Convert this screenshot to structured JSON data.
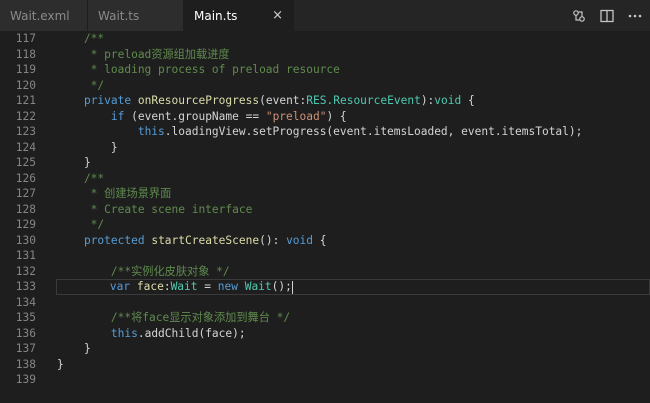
{
  "tabs": [
    {
      "label": "Wait.exml",
      "active": false
    },
    {
      "label": "Wait.ts",
      "active": false
    },
    {
      "label": "Main.ts",
      "active": true,
      "close": "×"
    }
  ],
  "tab_actions": [
    {
      "name": "open-changes-icon"
    },
    {
      "name": "split-editor-icon"
    },
    {
      "name": "more-actions-icon"
    }
  ],
  "colors": {
    "comment": "#608b4e",
    "keyword": "#569cd6",
    "function": "#dcdcaa",
    "type": "#4ec9b0",
    "string": "#ce9178",
    "text": "#d4d4d4",
    "line_number": "#858585",
    "background": "#1e1e1e"
  },
  "editor": {
    "current_line": 133,
    "lines": [
      {
        "num": "117",
        "tokens": [
          {
            "t": "    /**",
            "c": "cm"
          }
        ]
      },
      {
        "num": "118",
        "tokens": [
          {
            "t": "     * preload资源组加载进度",
            "c": "cm"
          }
        ]
      },
      {
        "num": "119",
        "tokens": [
          {
            "t": "     * loading process of preload resource",
            "c": "cm"
          }
        ]
      },
      {
        "num": "120",
        "tokens": [
          {
            "t": "     */",
            "c": "cm"
          }
        ]
      },
      {
        "num": "121",
        "tokens": [
          {
            "t": "    ",
            "c": "pl"
          },
          {
            "t": "private",
            "c": "kw"
          },
          {
            "t": " ",
            "c": "pl"
          },
          {
            "t": "onResourceProgress",
            "c": "fn"
          },
          {
            "t": "(",
            "c": "pl"
          },
          {
            "t": "event",
            "c": "pl"
          },
          {
            "t": ":",
            "c": "pl"
          },
          {
            "t": "RES.ResourceEvent",
            "c": "ty"
          },
          {
            "t": "):",
            "c": "pl"
          },
          {
            "t": "void",
            "c": "ty"
          },
          {
            "t": " {",
            "c": "pl"
          }
        ]
      },
      {
        "num": "122",
        "tokens": [
          {
            "t": "        ",
            "c": "pl"
          },
          {
            "t": "if",
            "c": "kw"
          },
          {
            "t": " (event.groupName == ",
            "c": "pl"
          },
          {
            "t": "\"preload\"",
            "c": "st"
          },
          {
            "t": ") {",
            "c": "pl"
          }
        ]
      },
      {
        "num": "123",
        "tokens": [
          {
            "t": "            ",
            "c": "pl"
          },
          {
            "t": "this",
            "c": "kw"
          },
          {
            "t": ".loadingView.setProgress(event.itemsLoaded, event.itemsTotal);",
            "c": "pl"
          }
        ]
      },
      {
        "num": "124",
        "tokens": [
          {
            "t": "        }",
            "c": "pl"
          }
        ]
      },
      {
        "num": "125",
        "tokens": [
          {
            "t": "    }",
            "c": "pl"
          }
        ]
      },
      {
        "num": "126",
        "tokens": [
          {
            "t": "    /**",
            "c": "cm"
          }
        ]
      },
      {
        "num": "127",
        "tokens": [
          {
            "t": "     * 创建场景界面",
            "c": "cm"
          }
        ]
      },
      {
        "num": "128",
        "tokens": [
          {
            "t": "     * Create scene interface",
            "c": "cm"
          }
        ]
      },
      {
        "num": "129",
        "tokens": [
          {
            "t": "     */",
            "c": "cm"
          }
        ]
      },
      {
        "num": "130",
        "tokens": [
          {
            "t": "    ",
            "c": "pl"
          },
          {
            "t": "protected",
            "c": "kw"
          },
          {
            "t": " ",
            "c": "pl"
          },
          {
            "t": "startCreateScene",
            "c": "fn"
          },
          {
            "t": "(): ",
            "c": "pl"
          },
          {
            "t": "void",
            "c": "kw"
          },
          {
            "t": " {",
            "c": "pl"
          }
        ]
      },
      {
        "num": "131",
        "tokens": []
      },
      {
        "num": "132",
        "tokens": [
          {
            "t": "        /**实例化皮肤对象 */",
            "c": "cm"
          }
        ]
      },
      {
        "num": "133",
        "tokens": [
          {
            "t": "        ",
            "c": "pl"
          },
          {
            "t": "var",
            "c": "kw"
          },
          {
            "t": " ",
            "c": "pl"
          },
          {
            "t": "face",
            "c": "fn"
          },
          {
            "t": ":",
            "c": "pl"
          },
          {
            "t": "Wait",
            "c": "ty"
          },
          {
            "t": " = ",
            "c": "pl"
          },
          {
            "t": "new",
            "c": "kw"
          },
          {
            "t": " ",
            "c": "pl"
          },
          {
            "t": "Wait",
            "c": "ty"
          },
          {
            "t": "();",
            "c": "pl"
          }
        ]
      },
      {
        "num": "134",
        "tokens": []
      },
      {
        "num": "135",
        "tokens": [
          {
            "t": "        /**将face显示对象添加到舞台 */",
            "c": "cm"
          }
        ]
      },
      {
        "num": "136",
        "tokens": [
          {
            "t": "        ",
            "c": "pl"
          },
          {
            "t": "this",
            "c": "kw"
          },
          {
            "t": ".addChild(face);",
            "c": "pl"
          }
        ]
      },
      {
        "num": "137",
        "tokens": [
          {
            "t": "    }",
            "c": "pl"
          }
        ]
      },
      {
        "num": "138",
        "tokens": [
          {
            "t": "}",
            "c": "pl"
          }
        ]
      },
      {
        "num": "139",
        "tokens": []
      }
    ]
  }
}
